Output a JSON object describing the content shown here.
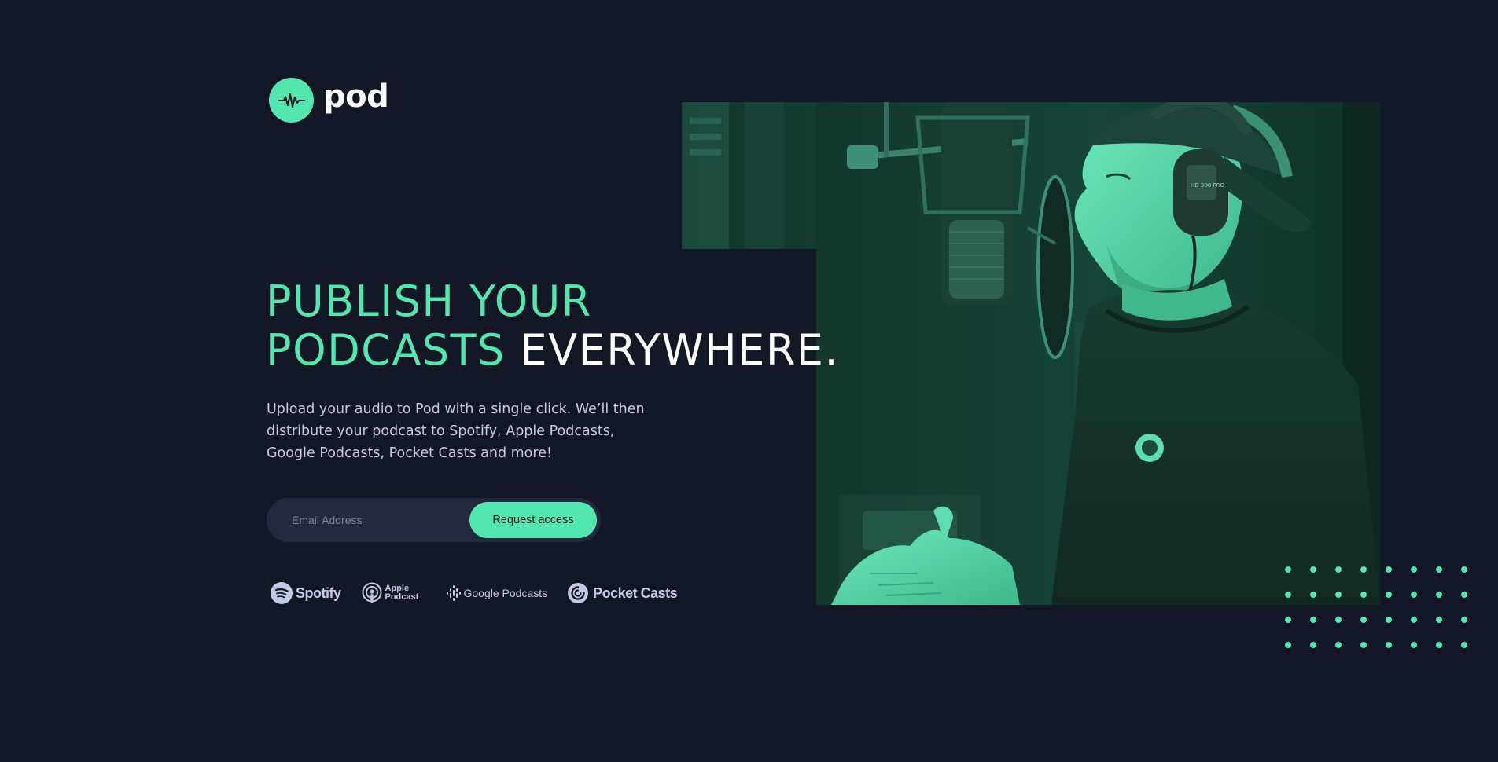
{
  "brand": {
    "name": "pod",
    "accent_color": "#54e6af",
    "background_color": "#121725"
  },
  "hero": {
    "headline_accent": "PUBLISH YOUR PODCASTS",
    "headline_plain": "EVERYWHERE.",
    "description": "Upload your audio to Pod with a single click. We’ll then distribute your podcast to Spotify, Apple Podcasts, Google Podcasts, Pocket Casts and more!"
  },
  "signup": {
    "email_placeholder": "Email Address",
    "email_value": "",
    "button_label": "Request access"
  },
  "platforms": {
    "spotify": "Spotify",
    "apple_line1": "Apple",
    "apple_line2": "Podcast",
    "google": "Google Podcasts",
    "pocket": "Pocket Casts"
  },
  "icons": {
    "logo": "audio-wave-icon",
    "spotify": "spotify-icon",
    "apple": "apple-podcasts-icon",
    "google": "google-podcasts-icon",
    "pocket": "pocket-casts-icon"
  }
}
